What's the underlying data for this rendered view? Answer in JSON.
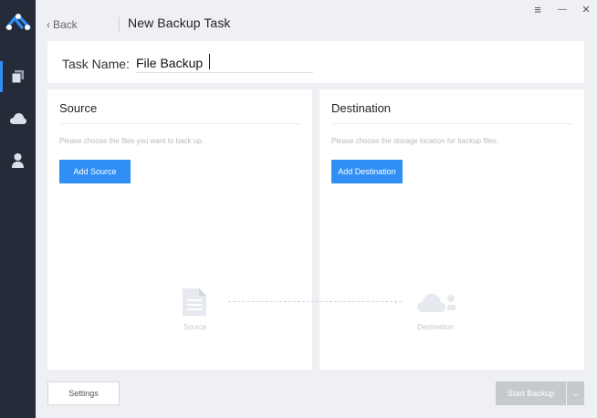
{
  "sidebar": {
    "items": [
      {
        "name": "backup-tasks",
        "icon": "copy-icon"
      },
      {
        "name": "cloud",
        "icon": "cloud-icon"
      },
      {
        "name": "account",
        "icon": "user-icon"
      }
    ],
    "accent": "#2f8ff5",
    "background": "#262b3a"
  },
  "window_controls": {
    "menu": "≡",
    "minimize": "—",
    "close": "✕"
  },
  "header": {
    "back_label": "Back",
    "title": "New Backup Task"
  },
  "task": {
    "label": "Task Name:",
    "value": "File Backup"
  },
  "source": {
    "title": "Source",
    "hint": "Please choose the files you want to back up.",
    "button": "Add Source"
  },
  "destination": {
    "title": "Destination",
    "hint": "Please choose the storage location for backup files.",
    "button": "Add Destination"
  },
  "flow": {
    "source_label": "Source",
    "destination_label": "Destination"
  },
  "footer": {
    "settings": "Settings",
    "start": "Start Backup"
  }
}
